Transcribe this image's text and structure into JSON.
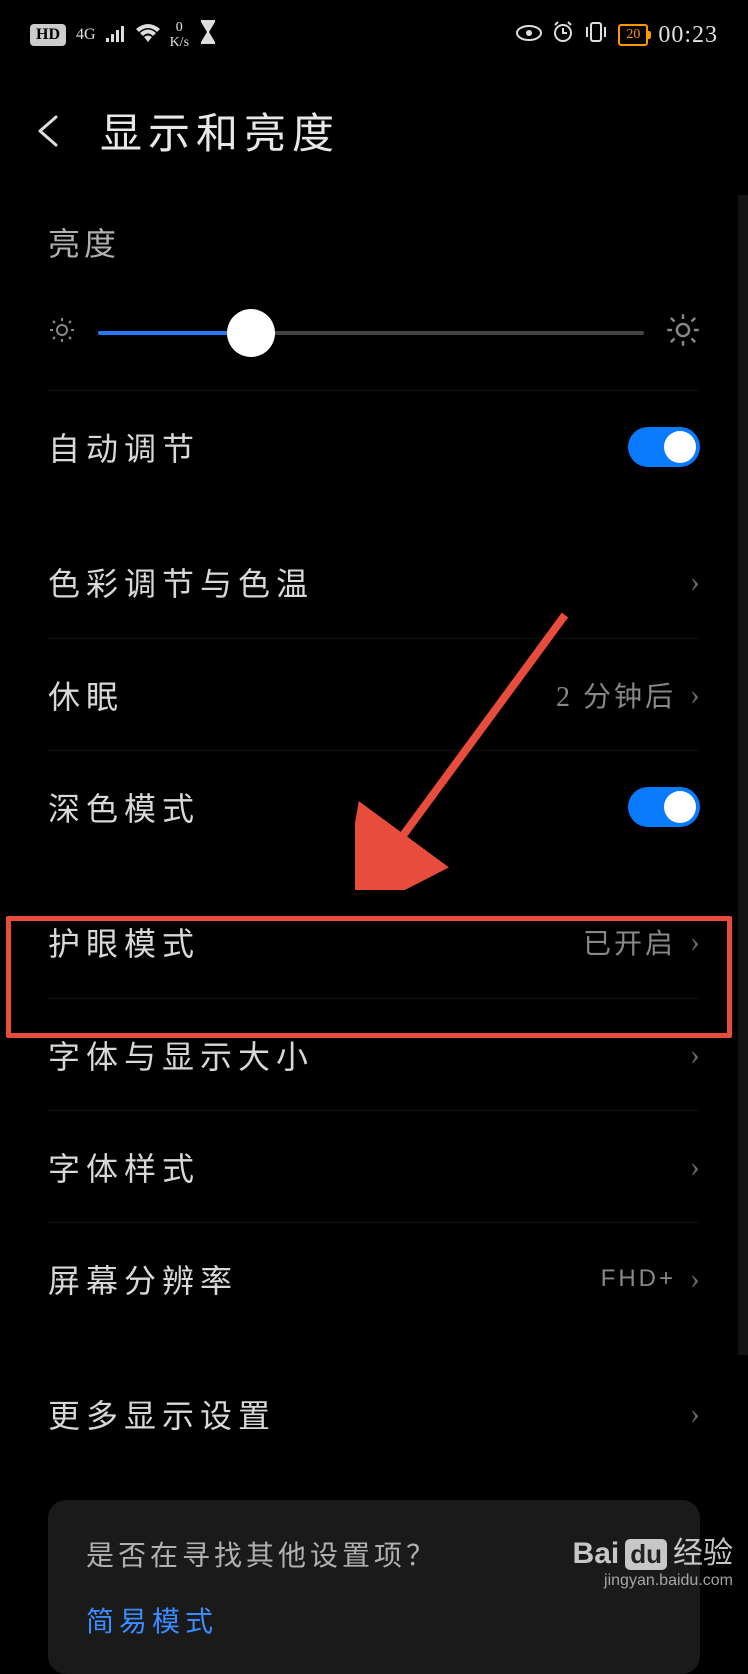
{
  "status": {
    "hd": "HD",
    "signal_type": "4G",
    "speed_top": "0",
    "speed_bottom": "K/s",
    "battery": "20",
    "time": "00:23"
  },
  "header": {
    "title": "显示和亮度"
  },
  "brightness": {
    "label": "亮度",
    "auto_label": "自动调节"
  },
  "group1": {
    "color": {
      "label": "色彩调节与色温"
    },
    "sleep": {
      "label": "休眠",
      "value": "2 分钟后"
    },
    "dark": {
      "label": "深色模式"
    }
  },
  "group2": {
    "eye": {
      "label": "护眼模式",
      "value": "已开启"
    },
    "font_size": {
      "label": "字体与显示大小"
    },
    "font_style": {
      "label": "字体样式"
    },
    "resolution": {
      "label": "屏幕分辨率",
      "value": "FHD+"
    }
  },
  "group3": {
    "more": {
      "label": "更多显示设置"
    }
  },
  "tip": {
    "question": "是否在寻找其他设置项？",
    "link": "简易模式"
  },
  "watermark": {
    "brand_a": "Bai",
    "brand_b": "du",
    "suffix": "经验",
    "url": "jingyan.baidu.com"
  }
}
